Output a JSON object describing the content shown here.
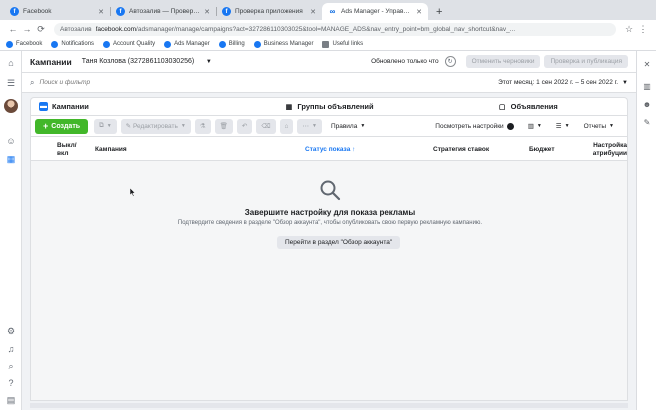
{
  "browser": {
    "tabs": [
      {
        "title": "Facebook",
        "favicon": "facebook-icon"
      },
      {
        "title": "Автозалив — Проверка прил...",
        "favicon": "facebook-icon"
      },
      {
        "title": "Проверка приложения",
        "favicon": "facebook-icon"
      },
      {
        "title": "Ads Manager - Управление р...",
        "favicon": "meta-icon"
      }
    ],
    "active_tab": 3,
    "new_tab": "+",
    "address": {
      "label": "Автозалив",
      "host": "facebook.com",
      "path": "/adsmanager/manage/campaigns?act=327286110303025&tool=MANAGE_ADS&nav_entry_point=bm_global_nav_shortcut&nav_..."
    },
    "bookmarks": [
      {
        "label": "Facebook",
        "icon": "facebook-icon"
      },
      {
        "label": "Notifications",
        "icon": "facebook-icon"
      },
      {
        "label": "Account Quality",
        "icon": "facebook-icon"
      },
      {
        "label": "Ads Manager",
        "icon": "facebook-icon"
      },
      {
        "label": "Billing",
        "icon": "facebook-icon"
      },
      {
        "label": "Business Manager",
        "icon": "facebook-icon"
      },
      {
        "label": "Useful links",
        "icon": "folder-icon"
      }
    ]
  },
  "header": {
    "title": "Кампании",
    "account": "Таня Козлова (327286110303025​6)",
    "published_only": "Обновлено только что",
    "discard": "Отменить черновики",
    "review_publish": "Проверка и публикация"
  },
  "search": {
    "placeholder": "Поиск и фильтр",
    "date_range": "Этот месяц: 1 сен 2022 г. – 5 сен 2022 г."
  },
  "levels": {
    "campaigns": "Кампании",
    "adsets": "Группы объявлений",
    "ads": "Объявления"
  },
  "toolbar": {
    "create": "Создать",
    "edit": "Редактировать",
    "rules": "Правила",
    "view_settings": "Посмотреть настройки",
    "reports": "Отчеты"
  },
  "table": {
    "columns": [
      "Выкл/вкл",
      "Кампания",
      "Статус показа ↑",
      "Стратегия ставок",
      "Бюджет",
      "Настройка атрибуции"
    ]
  },
  "empty_state": {
    "title": "Завершите настройку для показа рекламы",
    "body": "Подтвердите сведения в разделе \"Обзор аккаунта\", чтобы опубликовать свою первую рекламную кампанию.",
    "button": "Перейти в раздел \"Обзор аккаунта\""
  },
  "colors": {
    "fb_blue": "#1877f2",
    "create_green": "#42b72a",
    "bg": "#f0f2f5"
  }
}
